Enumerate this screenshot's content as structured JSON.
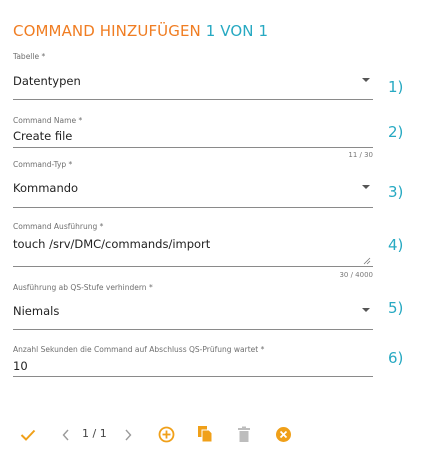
{
  "header": {
    "title": "COMMAND HINZUFÜGEN",
    "counter": "1 VON 1"
  },
  "fields": [
    {
      "label": "Tabelle *",
      "value": "Datentypen",
      "number": "1)"
    },
    {
      "label": "Command Name *",
      "value": "Create file",
      "counter": "11 / 30",
      "number": "2)"
    },
    {
      "label": "Command-Typ *",
      "value": "Kommando",
      "number": "3)"
    },
    {
      "label": "Command Ausführung *",
      "value": "touch /srv/DMC/commands/import",
      "counter": "30 / 4000",
      "number": "4)"
    },
    {
      "label": "Ausführung ab QS-Stufe verhindern *",
      "value": "Niemals",
      "number": "5)"
    },
    {
      "label": "Anzahl Sekunden die Command auf Abschluss QS-Prüfung wartet *",
      "value": "10",
      "number": "6)"
    }
  ],
  "toolbar": {
    "pager": "1 / 1",
    "icons": [
      "check-icon",
      "chevron-left-icon",
      "chevron-right-icon",
      "add-circle-icon",
      "copy-icon",
      "delete-icon",
      "cancel-icon"
    ]
  },
  "colors": {
    "accent_orange": "#f07d22",
    "accent_teal": "#27a9c2"
  }
}
